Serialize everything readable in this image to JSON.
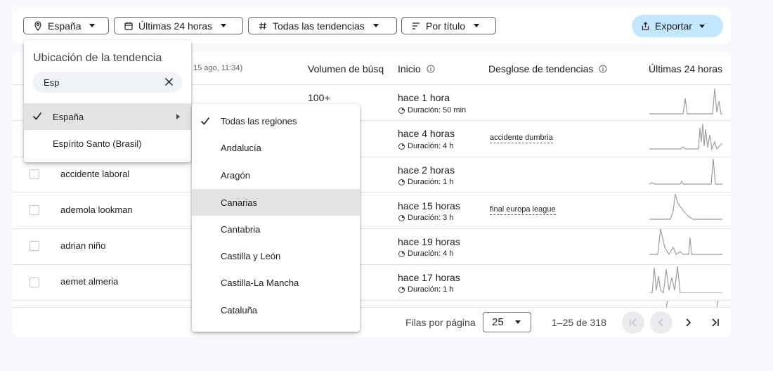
{
  "filters": {
    "location": "España",
    "time": "Últimas 24 horas",
    "category": "Todas las tendencias",
    "sort": "Por título",
    "export": "Exportar"
  },
  "table": {
    "headers": {
      "date_fragment": "15 ago, 11:34)",
      "volume": "Volumen de búsq",
      "start": "Inicio",
      "breakdown": "Desglose de tendencias",
      "last24": "Últimas 24 horas"
    },
    "volume_first": "100+",
    "rows": [
      {
        "title": "",
        "start": "hace 1 hora",
        "duration": "Duración: 50 min",
        "breakdown": ""
      },
      {
        "title": "",
        "start": "hace 4 horas",
        "duration": "Duración: 4 h",
        "breakdown": "accidente dumbria"
      },
      {
        "title": "accidente laboral",
        "start": "hace 2 horas",
        "duration": "Duración: 1 h",
        "breakdown": ""
      },
      {
        "title": "ademola lookman",
        "start": "hace 15 horas",
        "duration": "Duración: 3 h",
        "breakdown": "final europa league"
      },
      {
        "title": "adrian niño",
        "start": "hace 19 horas",
        "duration": "Duración: 4 h",
        "breakdown": ""
      },
      {
        "title": "aemet almeria",
        "start": "hace 17 horas",
        "duration": "Duración: 1 h",
        "breakdown": ""
      }
    ]
  },
  "pagination": {
    "rows_label": "Filas por página",
    "rows_per_page": "25",
    "range": "1–25 de 318"
  },
  "location_dropdown": {
    "title": "Ubicación de la tendencia",
    "search_value": "Esp",
    "items": [
      {
        "label": "España",
        "selected": true
      },
      {
        "label": "Espírito Santo (Brasil)",
        "selected": false
      }
    ]
  },
  "region_dropdown": {
    "items": [
      {
        "label": "Todas las regiones",
        "selected": true
      },
      {
        "label": "Andalucía",
        "selected": false
      },
      {
        "label": "Aragón",
        "selected": false
      },
      {
        "label": "Canarias",
        "selected": false
      },
      {
        "label": "Cantabria",
        "selected": false
      },
      {
        "label": "Castilla y León",
        "selected": false
      },
      {
        "label": "Castilla-La Mancha",
        "selected": false
      },
      {
        "label": "Cataluña",
        "selected": false
      }
    ]
  },
  "colors": {
    "accent": "#c2e7ff",
    "spark": "#9e9e9e"
  }
}
